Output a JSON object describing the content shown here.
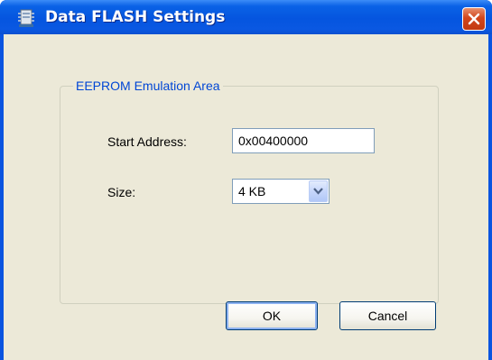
{
  "window": {
    "title": "Data FLASH Settings"
  },
  "icons": {
    "app": "flash-chip-icon",
    "close": "close-icon",
    "dropdown": "chevron-down-icon"
  },
  "eeprom": {
    "group_label": "EEPROM Emulation Area",
    "start_address_label": "Start Address:",
    "start_address_value": "0x00400000",
    "size_label": "Size:",
    "size_value": "4 KB"
  },
  "buttons": {
    "ok_label": "OK",
    "cancel_label": "Cancel"
  },
  "colors": {
    "titlebar": "#0555df",
    "close_button": "#d2461c",
    "dialog_background": "#ece9d8",
    "group_label": "#0046d5",
    "input_border": "#7f9db9",
    "default_button_focus": "#8db2f0"
  }
}
